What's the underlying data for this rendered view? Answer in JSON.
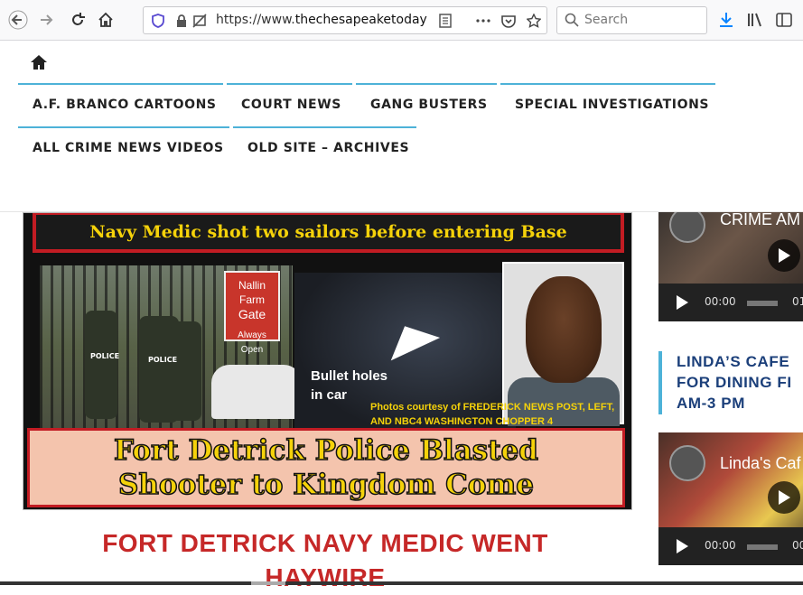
{
  "browser": {
    "url_scheme": "https://www.",
    "url_host": "thechesapeaketoday",
    "search_placeholder": "Search"
  },
  "nav": {
    "items": [
      {
        "label": "A.F. BRANCO CARTOONS"
      },
      {
        "label": "COURT NEWS"
      },
      {
        "label": "GANG BUSTERS"
      },
      {
        "label": "SPECIAL INVESTIGATIONS"
      },
      {
        "label": "ALL CRIME NEWS VIDEOS"
      },
      {
        "label": "OLD SITE – ARCHIVES"
      }
    ]
  },
  "feature": {
    "top_banner": "Navy Medic shot two sailors before entering Base",
    "sign_line1": "Nallin Farm",
    "sign_line2": "Gate",
    "sign_line3": "Always Open",
    "police_label": "POLICE",
    "bullet_line1": "Bullet holes",
    "bullet_line2": "in car",
    "courtesy_line1": "Photos courtesy of FREDERICK NEWS POST, LEFT,",
    "courtesy_line2": "AND NBC4 WASHINGTON CHOPPER 4",
    "bottom_line1": "Fort Detrick Police Blasted",
    "bottom_line2": "Shooter to Kingdom Come"
  },
  "article": {
    "title_line1": "FORT DETRICK NAVY MEDIC WENT",
    "title_line2": "HAYWIRE"
  },
  "sidebar": {
    "video1": {
      "title": "CRIME AM",
      "time": "00:00",
      "end": "01"
    },
    "heading_line1": "LINDA’S CAFE",
    "heading_line2": "FOR DINING FI",
    "heading_line3": "AM-3 PM",
    "video2": {
      "title": "Linda's Caf",
      "time": "00:00",
      "end": "00"
    }
  },
  "colors": {
    "nav_accent": "#4db2d8",
    "title_red": "#c62828",
    "side_heading": "#1b3f7a"
  }
}
